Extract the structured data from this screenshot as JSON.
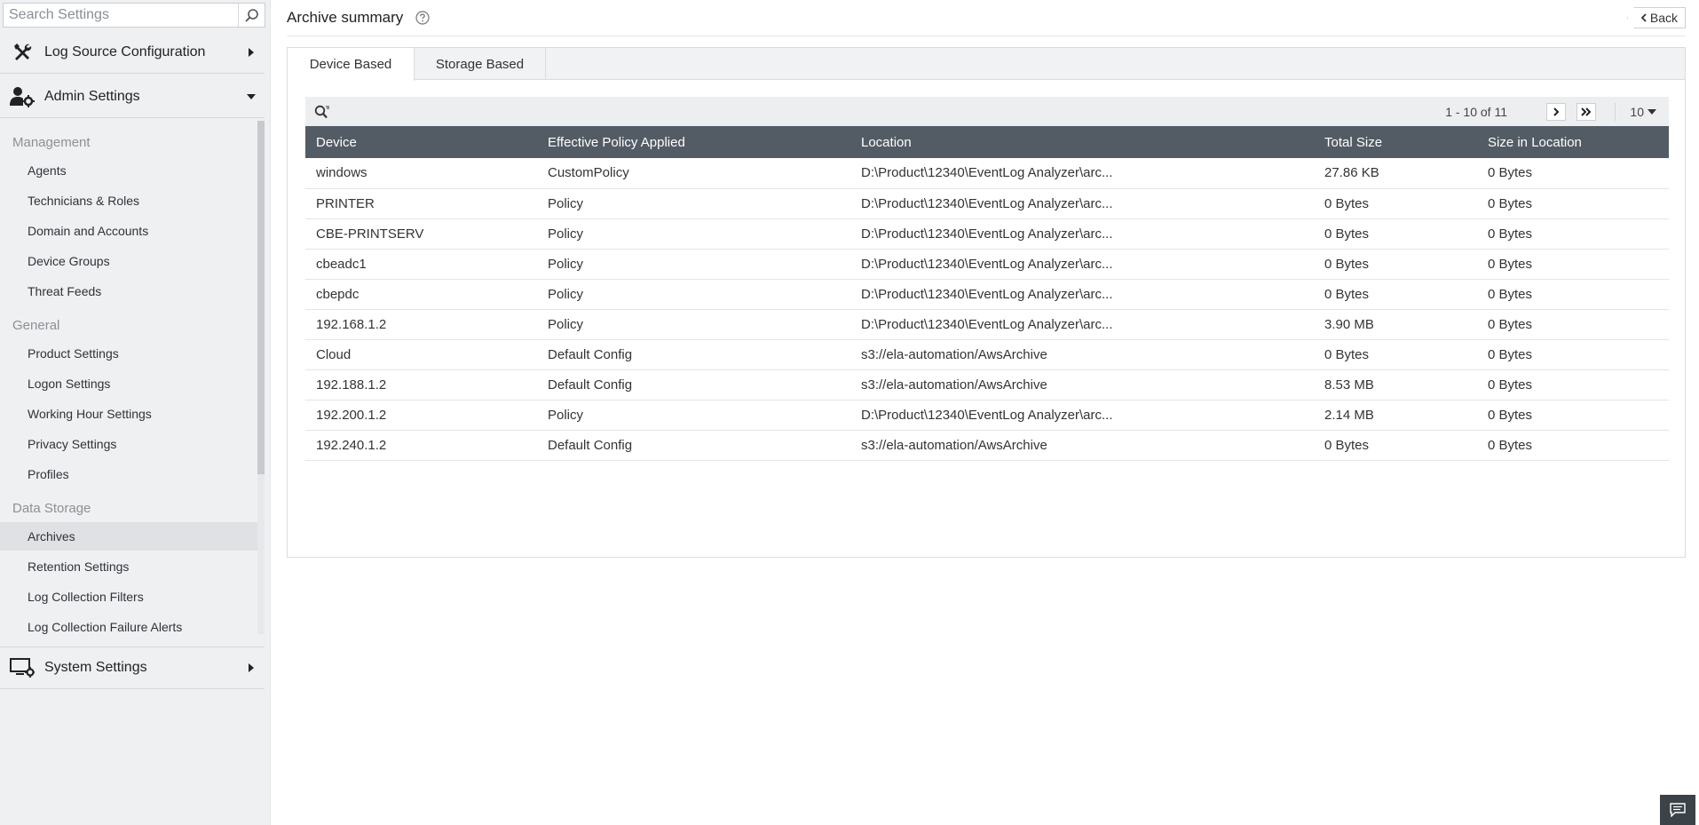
{
  "sidebar": {
    "search_placeholder": "Search Settings",
    "sections": {
      "log_source": "Log Source Configuration",
      "admin": "Admin Settings",
      "system": "System Settings"
    },
    "groups": {
      "management": {
        "label": "Management",
        "items": [
          "Agents",
          "Technicians & Roles",
          "Domain and Accounts",
          "Device Groups",
          "Threat Feeds"
        ]
      },
      "general": {
        "label": "General",
        "items": [
          "Product Settings",
          "Logon Settings",
          "Working Hour Settings",
          "Privacy Settings",
          "Profiles"
        ]
      },
      "data_storage": {
        "label": "Data Storage",
        "items": [
          "Archives",
          "Retention Settings",
          "Log Collection Filters",
          "Log Collection Failure Alerts"
        ]
      }
    },
    "active_item": "Archives"
  },
  "header": {
    "title": "Archive summary",
    "back_label": "Back"
  },
  "tabs": {
    "device_based": "Device Based",
    "storage_based": "Storage Based",
    "active": "Device Based"
  },
  "pager": {
    "range_text": "1 - 10 of 11",
    "per_page": "10"
  },
  "table": {
    "columns": [
      "Device",
      "Effective Policy Applied",
      "Location",
      "Total Size",
      "Size in Location"
    ],
    "rows": [
      [
        "windows",
        "CustomPolicy",
        "D:\\Product\\12340\\EventLog Analyzer\\arc...",
        "27.86 KB",
        "0 Bytes"
      ],
      [
        "PRINTER",
        "Policy",
        "D:\\Product\\12340\\EventLog Analyzer\\arc...",
        "0 Bytes",
        "0 Bytes"
      ],
      [
        "CBE-PRINTSERV",
        "Policy",
        "D:\\Product\\12340\\EventLog Analyzer\\arc...",
        "0 Bytes",
        "0 Bytes"
      ],
      [
        "cbeadc1",
        "Policy",
        "D:\\Product\\12340\\EventLog Analyzer\\arc...",
        "0 Bytes",
        "0 Bytes"
      ],
      [
        "cbepdc",
        "Policy",
        "D:\\Product\\12340\\EventLog Analyzer\\arc...",
        "0 Bytes",
        "0 Bytes"
      ],
      [
        "192.168.1.2",
        "Policy",
        "D:\\Product\\12340\\EventLog Analyzer\\arc...",
        "3.90 MB",
        "0 Bytes"
      ],
      [
        "Cloud",
        "Default Config",
        "s3://ela-automation/AwsArchive",
        "0 Bytes",
        "0 Bytes"
      ],
      [
        "192.188.1.2",
        "Default Config",
        "s3://ela-automation/AwsArchive",
        "8.53 MB",
        "0 Bytes"
      ],
      [
        "192.200.1.2",
        "Policy",
        "D:\\Product\\12340\\EventLog Analyzer\\arc...",
        "2.14 MB",
        "0 Bytes"
      ],
      [
        "192.240.1.2",
        "Default Config",
        "s3://ela-automation/AwsArchive",
        "0 Bytes",
        "0 Bytes"
      ]
    ]
  },
  "icons": {
    "search": "search-icon",
    "tools": "tools-icon",
    "admin": "user-gear-icon",
    "system": "monitor-gear-icon",
    "help": "help-circle-icon",
    "chat": "chat-icon"
  },
  "colors": {
    "table_header": "#535c65",
    "sidebar_bg": "#eef0f2",
    "active_item_bg": "#dfe1e4"
  }
}
